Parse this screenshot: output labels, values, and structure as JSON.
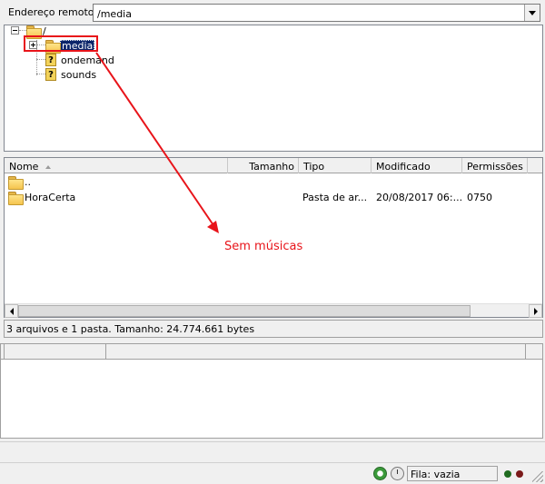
{
  "remote_bar": {
    "label": "Endereço remoto:",
    "path_value": "/media"
  },
  "tree": {
    "root_label": "/",
    "items": [
      {
        "label": "media",
        "icon": "folder-icon",
        "selected": true
      },
      {
        "label": "ondemand",
        "icon": "question-icon"
      },
      {
        "label": "sounds",
        "icon": "question-icon"
      }
    ]
  },
  "annotation": {
    "text": "Sem músicas",
    "color": "#e8141a"
  },
  "file_list": {
    "columns": [
      "Nome",
      "Tamanho",
      "Tipo",
      "Modificado",
      "Permissões"
    ],
    "rows": [
      {
        "name": "..",
        "size": "",
        "type": "",
        "modified": "",
        "permissions": ""
      },
      {
        "name": "HoraCerta",
        "size": "",
        "type": "Pasta de ar...",
        "modified": "20/08/2017 06:...",
        "permissions": "0750"
      }
    ]
  },
  "summary": {
    "text": "3 arquivos e 1 pasta. Tamanho: 24.774.661 bytes"
  },
  "status": {
    "queue_text": "Fila: vazia"
  },
  "colors": {
    "selection": "#0a246a",
    "annotation": "#e8141a"
  }
}
